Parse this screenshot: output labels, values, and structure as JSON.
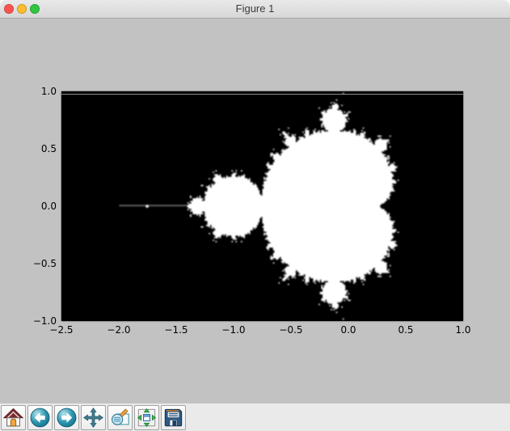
{
  "window": {
    "title": "Figure 1",
    "controls": {
      "close": "close",
      "minimize": "minimize",
      "zoom": "zoom"
    }
  },
  "chart_data": {
    "type": "heatmap",
    "title": "",
    "description": "Mandelbrot set fractal rendered white (inside set) on black (escaped)",
    "xlim": [
      -2.5,
      1.0
    ],
    "ylim": [
      -1.0,
      1.0
    ],
    "x_tick_values": [
      -2.5,
      -2.0,
      -1.5,
      -1.0,
      -0.5,
      0.0,
      0.5,
      1.0
    ],
    "x_tick_labels": [
      "−2.5",
      "−2.0",
      "−1.5",
      "−1.0",
      "−0.5",
      "0.0",
      "0.5",
      "1.0"
    ],
    "y_tick_values": [
      1.0,
      0.5,
      0.0,
      -0.5,
      -1.0
    ],
    "y_tick_labels": [
      "1.0",
      "0.5",
      "0.0",
      "−0.5",
      "−1.0"
    ],
    "max_iter": 35,
    "colors": {
      "inside": "#ffffff",
      "outside": "#000000",
      "figure_bg": "#c2c2c2"
    },
    "grid": false,
    "legend": false
  },
  "toolbar": {
    "buttons": [
      {
        "name": "home",
        "icon": "home-icon"
      },
      {
        "name": "back",
        "icon": "back-arrow-icon"
      },
      {
        "name": "forward",
        "icon": "forward-arrow-icon"
      },
      {
        "name": "pan",
        "icon": "pan-arrows-icon"
      },
      {
        "name": "zoom-to-rect",
        "icon": "zoom-rect-icon"
      },
      {
        "name": "configure-subplots",
        "icon": "subplots-icon"
      },
      {
        "name": "save",
        "icon": "save-floppy-icon"
      }
    ]
  }
}
